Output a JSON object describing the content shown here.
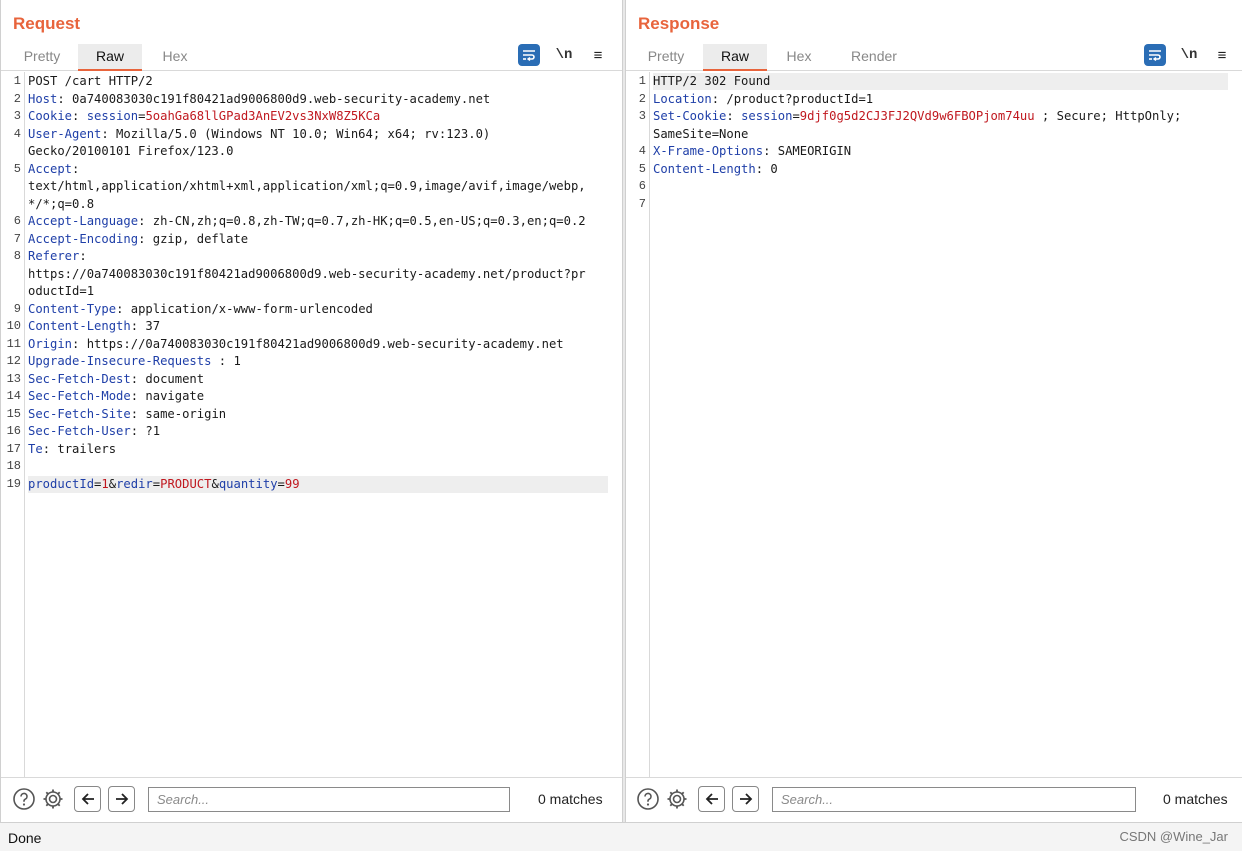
{
  "request": {
    "title": "Request",
    "tabs": [
      "Pretty",
      "Raw",
      "Hex"
    ],
    "active_tab": "Raw",
    "icons": [
      "wrap-lines-icon",
      "newline-toggle-icon",
      "menu-icon"
    ],
    "newline_label": "\\n",
    "menu_glyph": "≡",
    "lines": [
      {
        "n": "1",
        "parts": [
          {
            "t": "POST /cart HTTP/2",
            "c": "p"
          }
        ]
      },
      {
        "n": "2",
        "parts": [
          {
            "t": "Host",
            "c": "k"
          },
          {
            "t": ": 0a740083030c191f80421ad9006800d9.web-security-academy.net",
            "c": "p"
          }
        ]
      },
      {
        "n": "3",
        "parts": [
          {
            "t": "Cookie",
            "c": "k"
          },
          {
            "t": ": ",
            "c": "p"
          },
          {
            "t": "session",
            "c": "k"
          },
          {
            "t": "=",
            "c": "p"
          },
          {
            "t": "5oahGa68llGPad3AnEV2vs3NxW8Z5KCa",
            "c": "v"
          }
        ]
      },
      {
        "n": "4",
        "parts": [
          {
            "t": "User-Agent",
            "c": "k"
          },
          {
            "t": ": Mozilla/5.0 (Windows NT 10.0; Win64; x64; rv:123.0)",
            "c": "p"
          }
        ]
      },
      {
        "n": "",
        "parts": [
          {
            "t": "Gecko/20100101 Firefox/123.0",
            "c": "p"
          }
        ]
      },
      {
        "n": "5",
        "parts": [
          {
            "t": "Accept",
            "c": "k"
          },
          {
            "t": ":",
            "c": "p"
          }
        ]
      },
      {
        "n": "",
        "parts": [
          {
            "t": "text/html,application/xhtml+xml,application/xml;q=0.9,image/avif,image/webp,",
            "c": "p"
          }
        ]
      },
      {
        "n": "",
        "parts": [
          {
            "t": "*/*;q=0.8",
            "c": "p"
          }
        ]
      },
      {
        "n": "6",
        "parts": [
          {
            "t": "Accept-Language",
            "c": "k"
          },
          {
            "t": ": zh-CN,zh;q=0.8,zh-TW;q=0.7,zh-HK;q=0.5,en-US;q=0.3,en;q=0.2",
            "c": "p"
          }
        ]
      },
      {
        "n": "7",
        "parts": [
          {
            "t": "Accept-Encoding",
            "c": "k"
          },
          {
            "t": ": gzip, deflate",
            "c": "p"
          }
        ]
      },
      {
        "n": "8",
        "parts": [
          {
            "t": "Referer",
            "c": "k"
          },
          {
            "t": ":",
            "c": "p"
          }
        ]
      },
      {
        "n": "",
        "parts": [
          {
            "t": "https://0a740083030c191f80421ad9006800d9.web-security-academy.net/product?pr",
            "c": "p"
          }
        ]
      },
      {
        "n": "",
        "parts": [
          {
            "t": "oductId=1",
            "c": "p"
          }
        ]
      },
      {
        "n": "9",
        "parts": [
          {
            "t": "Content-Type",
            "c": "k"
          },
          {
            "t": ": application/x-www-form-urlencoded",
            "c": "p"
          }
        ]
      },
      {
        "n": "10",
        "parts": [
          {
            "t": "Content-Length",
            "c": "k"
          },
          {
            "t": ": 37",
            "c": "p"
          }
        ]
      },
      {
        "n": "11",
        "parts": [
          {
            "t": "Origin",
            "c": "k"
          },
          {
            "t": ": https://0a740083030c191f80421ad9006800d9.web-security-academy.net",
            "c": "p"
          }
        ]
      },
      {
        "n": "12",
        "parts": [
          {
            "t": "Upgrade-Insecure-Requests",
            "c": "k"
          },
          {
            "t": " : 1",
            "c": "p"
          }
        ]
      },
      {
        "n": "13",
        "parts": [
          {
            "t": "Sec-Fetch-Dest",
            "c": "k"
          },
          {
            "t": ": document",
            "c": "p"
          }
        ]
      },
      {
        "n": "14",
        "parts": [
          {
            "t": "Sec-Fetch-Mode",
            "c": "k"
          },
          {
            "t": ": navigate",
            "c": "p"
          }
        ]
      },
      {
        "n": "15",
        "parts": [
          {
            "t": "Sec-Fetch-Site",
            "c": "k"
          },
          {
            "t": ": same-origin",
            "c": "p"
          }
        ]
      },
      {
        "n": "16",
        "parts": [
          {
            "t": "Sec-Fetch-User",
            "c": "k"
          },
          {
            "t": ": ?1",
            "c": "p"
          }
        ]
      },
      {
        "n": "17",
        "parts": [
          {
            "t": "Te",
            "c": "k"
          },
          {
            "t": ": trailers",
            "c": "p"
          }
        ]
      },
      {
        "n": "18",
        "parts": []
      },
      {
        "n": "19",
        "hl": true,
        "parts": [
          {
            "t": "productId",
            "c": "k"
          },
          {
            "t": "=",
            "c": "p"
          },
          {
            "t": "1",
            "c": "v"
          },
          {
            "t": "&",
            "c": "p"
          },
          {
            "t": "redir",
            "c": "k"
          },
          {
            "t": "=",
            "c": "p"
          },
          {
            "t": "PRODUCT",
            "c": "v"
          },
          {
            "t": "&",
            "c": "p"
          },
          {
            "t": "quantity",
            "c": "k"
          },
          {
            "t": "=",
            "c": "p"
          },
          {
            "t": "99",
            "c": "v"
          }
        ]
      }
    ],
    "search_placeholder": "Search...",
    "matches": "0 matches"
  },
  "response": {
    "title": "Response",
    "tabs": [
      "Pretty",
      "Raw",
      "Hex",
      "Render"
    ],
    "active_tab": "Raw",
    "icons": [
      "wrap-lines-icon",
      "newline-toggle-icon",
      "menu-icon"
    ],
    "newline_label": "\\n",
    "menu_glyph": "≡",
    "lines": [
      {
        "n": "1",
        "hl": true,
        "parts": [
          {
            "t": "HTTP/2 302 Found",
            "c": "p"
          }
        ]
      },
      {
        "n": "2",
        "parts": [
          {
            "t": "Location",
            "c": "k"
          },
          {
            "t": ": /product?productId=1",
            "c": "p"
          }
        ]
      },
      {
        "n": "3",
        "parts": [
          {
            "t": "Set-Cookie",
            "c": "k"
          },
          {
            "t": ": ",
            "c": "p"
          },
          {
            "t": "session",
            "c": "k"
          },
          {
            "t": "=",
            "c": "p"
          },
          {
            "t": "9djf0g5d2CJ3FJ2QVd9w6FBOPjom74uu",
            "c": "v"
          },
          {
            "t": " ; Secure; HttpOnly;",
            "c": "p"
          }
        ]
      },
      {
        "n": "",
        "parts": [
          {
            "t": "SameSite=None",
            "c": "p"
          }
        ]
      },
      {
        "n": "4",
        "parts": [
          {
            "t": "X-Frame-Options",
            "c": "k"
          },
          {
            "t": ": SAMEORIGIN",
            "c": "p"
          }
        ]
      },
      {
        "n": "5",
        "parts": [
          {
            "t": "Content-Length",
            "c": "k"
          },
          {
            "t": ": 0",
            "c": "p"
          }
        ]
      },
      {
        "n": "6",
        "parts": []
      },
      {
        "n": "7",
        "parts": []
      }
    ],
    "search_placeholder": "Search...",
    "matches": "0 matches"
  },
  "layout_switch": {
    "icons": [
      "split-vertical-icon",
      "split-horizontal-icon",
      "tabbed-layout-icon"
    ],
    "active": 0
  },
  "footer_icons": [
    "help-icon",
    "settings-icon",
    "arrow-left-icon",
    "arrow-right-icon"
  ],
  "status": {
    "text": "Done",
    "watermark": "CSDN @Wine_Jar"
  },
  "colors": {
    "title": "#e8643c",
    "key": "#1f3fa8",
    "value": "#c0181f",
    "accent": "#2a6db5"
  }
}
